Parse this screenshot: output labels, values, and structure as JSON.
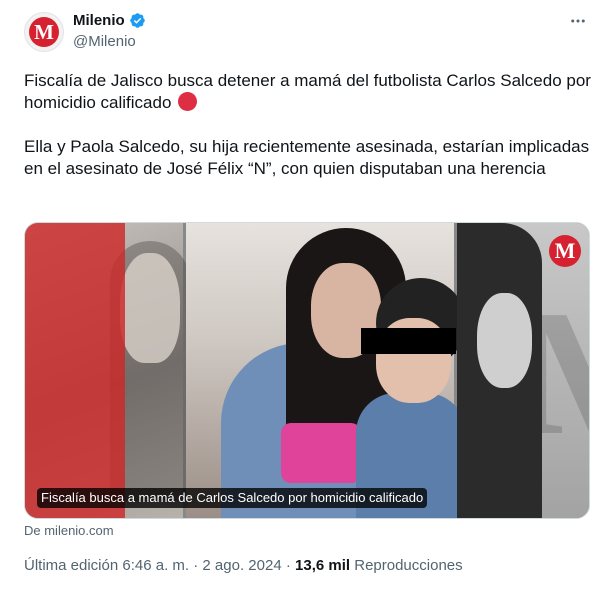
{
  "author": {
    "display_name": "Milenio",
    "handle": "@Milenio",
    "avatar_letter": "M",
    "verified_icon": "verified-badge-icon",
    "brand_color": "#d62230"
  },
  "tweet": {
    "text_line1": "Fiscalía de Jalisco busca detener a mamá del futbolista Carlos Salcedo por homicidio calificado",
    "emoji": "red-circle",
    "text_paragraph2": "Ella y Paola Salcedo, su hija recientemente asesinada, estarían implicadas en el asesinato de José Félix “N”, con quien disputaban una herencia"
  },
  "card": {
    "caption": "Fiscalía busca a mamá de Carlos Salcedo por homicidio calificado",
    "logo_letter": "M",
    "source": "De milenio.com"
  },
  "meta": {
    "edited": "Última edición 6:46 a. m.",
    "separator": " · ",
    "date": "2 ago. 2024",
    "views_count": "13,6 mil",
    "views_label": "Reproducciones"
  }
}
